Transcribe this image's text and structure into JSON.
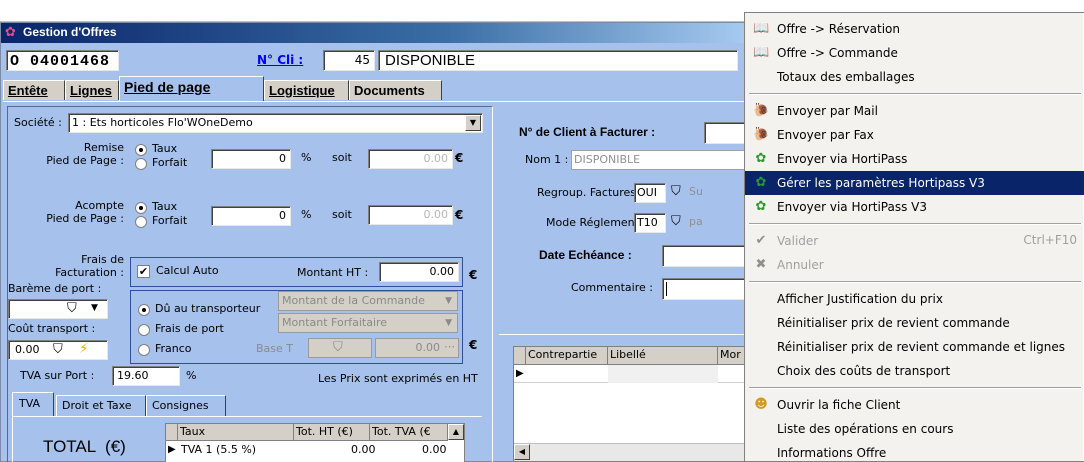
{
  "window": {
    "title": "Gestion d'Offres"
  },
  "header": {
    "offer_number": "O 04001468",
    "client_link": "N° Cli :",
    "client_number": "45",
    "client_name": "DISPONIBLE"
  },
  "tabs": [
    "Entête",
    "Lignes",
    "Pied de page",
    "Logistique",
    "Documents"
  ],
  "footer": {
    "societe_label": "Société :",
    "societe_value": "1 : Ets horticoles Flo'WOneDemo",
    "remise_label": "Remise\nPied de Page :",
    "radio_taux": "Taux",
    "radio_forfait": "Forfait",
    "remise_value": "0",
    "percent": "%",
    "soit": "soit",
    "remise_amount": "0.00",
    "euro": "€",
    "acompte_label": "Acompte\nPied de Page :",
    "acompte_value": "0",
    "acompte_amount": "0.00",
    "frais_label": "Frais de\nFacturation :",
    "calcul_auto": "Calcul Auto",
    "montant_ht_label": "Montant HT :",
    "montant_ht_value": "0.00",
    "bareme_label": "Barème de port :",
    "cout_label": "Coût transport :",
    "cout_value": "0.00",
    "radio_du_transporteur": "Dû au transporteur",
    "radio_frais_port": "Frais de port",
    "radio_franco": "Franco",
    "montant_commande": "Montant de la Commande",
    "montant_forfaitaire": "Montant Forfaitaire",
    "base_t": "Base T",
    "base_value": "0.00",
    "tva_port_label": "TVA sur Port :",
    "tva_port_value": "19.60",
    "prix_note": "Les Prix sont exprimés en HT"
  },
  "bottom_tabs": [
    "TVA",
    "Droit et Taxe",
    "Consignes"
  ],
  "tva_grid": {
    "total_label": "TOTAL  (€)",
    "columns": [
      "Taux",
      "Tot. HT (€)",
      "Tot. TVA (€"
    ],
    "rows": [
      {
        "taux": "TVA 1 (5.5 %)",
        "ht": "0.00",
        "tva": "0.00"
      }
    ]
  },
  "right_panel": {
    "client_facturer": "N° de Client à Facturer :",
    "nom1_label": "Nom 1 :",
    "nom1_value": "DISPONIBLE",
    "regroup_label": "Regroup. Factures :",
    "regroup_value": "OUI",
    "regroup_extra": "Su",
    "mode_label": "Mode Réglement :",
    "mode_value": "T10",
    "mode_extra": "pa",
    "date_label": "Date Echéance :",
    "commentaire_label": "Commentaire :"
  },
  "contre_grid": {
    "columns": [
      "Contrepartie",
      "Libellé",
      "Mor"
    ]
  },
  "context_menu": {
    "items": [
      {
        "label": "Offre -> Réservation",
        "icon": "book-icon",
        "enabled": true
      },
      {
        "label": "Offre -> Commande",
        "icon": "book-icon",
        "enabled": true
      },
      {
        "label": "Totaux des emballages",
        "icon": "",
        "enabled": true
      },
      {
        "sep": true
      },
      {
        "label": "Envoyer par Mail",
        "icon": "mail-icon",
        "enabled": true
      },
      {
        "label": "Envoyer par Fax",
        "icon": "fax-icon",
        "enabled": true
      },
      {
        "label": "Envoyer via HortiPass",
        "icon": "hortipass-icon",
        "enabled": true
      },
      {
        "label": "Gérer les paramètres Hortipass V3",
        "icon": "hortipass-icon",
        "enabled": true,
        "highlighted": true
      },
      {
        "label": "Envoyer via HortiPass V3",
        "icon": "hortipass-icon",
        "enabled": true
      },
      {
        "sep": true
      },
      {
        "label": "Valider",
        "icon": "check-icon",
        "enabled": false,
        "shortcut": "Ctrl+F10"
      },
      {
        "label": "Annuler",
        "icon": "cancel-icon",
        "enabled": false
      },
      {
        "sep": true
      },
      {
        "label": "Afficher Justification du prix",
        "icon": "",
        "enabled": true
      },
      {
        "label": "Réinitialiser prix de revient commande",
        "icon": "",
        "enabled": true
      },
      {
        "label": "Réinitialiser prix de revient commande et lignes",
        "icon": "",
        "enabled": true
      },
      {
        "label": "Choix des coûts de transport",
        "icon": "",
        "enabled": true
      },
      {
        "sep": true
      },
      {
        "label": "Ouvrir la fiche Client",
        "icon": "client-icon",
        "enabled": true
      },
      {
        "label": "Liste des opérations en cours",
        "icon": "",
        "enabled": true
      },
      {
        "label": "Informations Offre",
        "icon": "",
        "enabled": true
      }
    ]
  },
  "colors": {
    "titlebar_start": "#0a246a",
    "titlebar_end": "#a6caf0",
    "form_blue": "#a6c2ec",
    "menu_highlight": "#0a246a",
    "link_blue": "#0000ff"
  }
}
